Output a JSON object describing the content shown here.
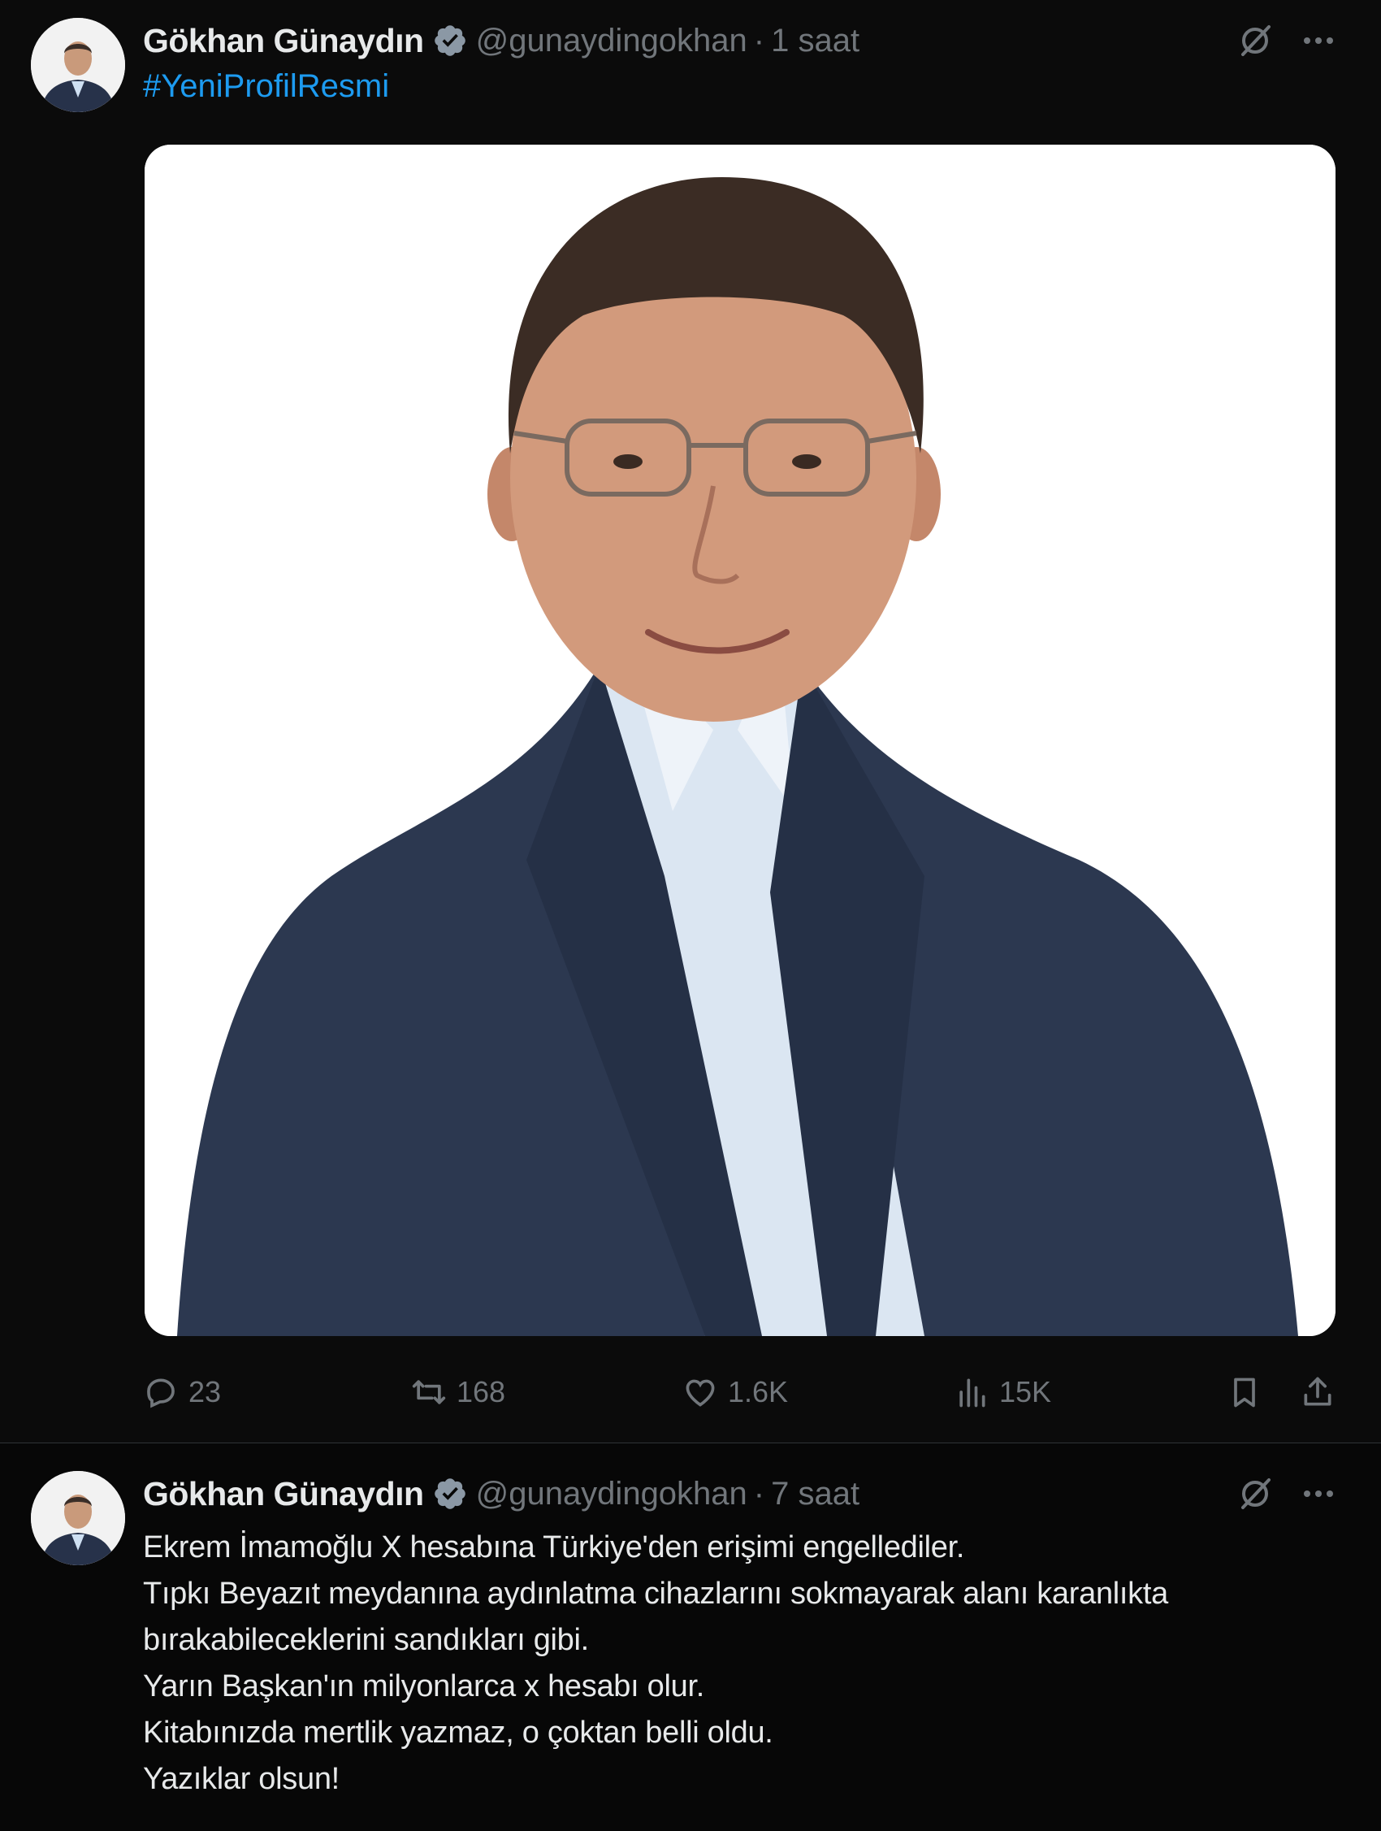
{
  "tweets": [
    {
      "author": {
        "name": "Gökhan Günaydın",
        "handle": "@gunaydingokhan"
      },
      "separator": "·",
      "time": "1 saat",
      "hashtag": "#YeniProfilResmi",
      "stats": {
        "replies": "23",
        "reposts": "168",
        "likes": "1.6K",
        "views": "15K"
      }
    },
    {
      "author": {
        "name": "Gökhan Günaydın",
        "handle": "@gunaydingokhan"
      },
      "separator": "·",
      "time": "7 saat",
      "lines": [
        "Ekrem İmamoğlu X hesabına Türkiye'den erişimi engellediler.",
        "Tıpkı Beyazıt meydanına aydınlatma cihazlarını sokmayarak alanı karanlıkta",
        "bırakabileceklerini sandıkları gibi.",
        "Yarın Başkan'ın milyonlarca x hesabı olur.",
        "Kitabınızda mertlik yazmaz, o çoktan belli oldu.",
        "Yazıklar olsun!"
      ]
    }
  ],
  "icons": [
    "verified-badge-icon",
    "grok-icon",
    "more-icon",
    "reply-icon",
    "repost-icon",
    "like-icon",
    "views-icon",
    "bookmark-icon",
    "share-icon"
  ],
  "colors": {
    "background": "#000000",
    "text": "#e7e9ea",
    "muted": "#71767b",
    "link": "#1d9bf0",
    "verified": "#8b98a5"
  }
}
